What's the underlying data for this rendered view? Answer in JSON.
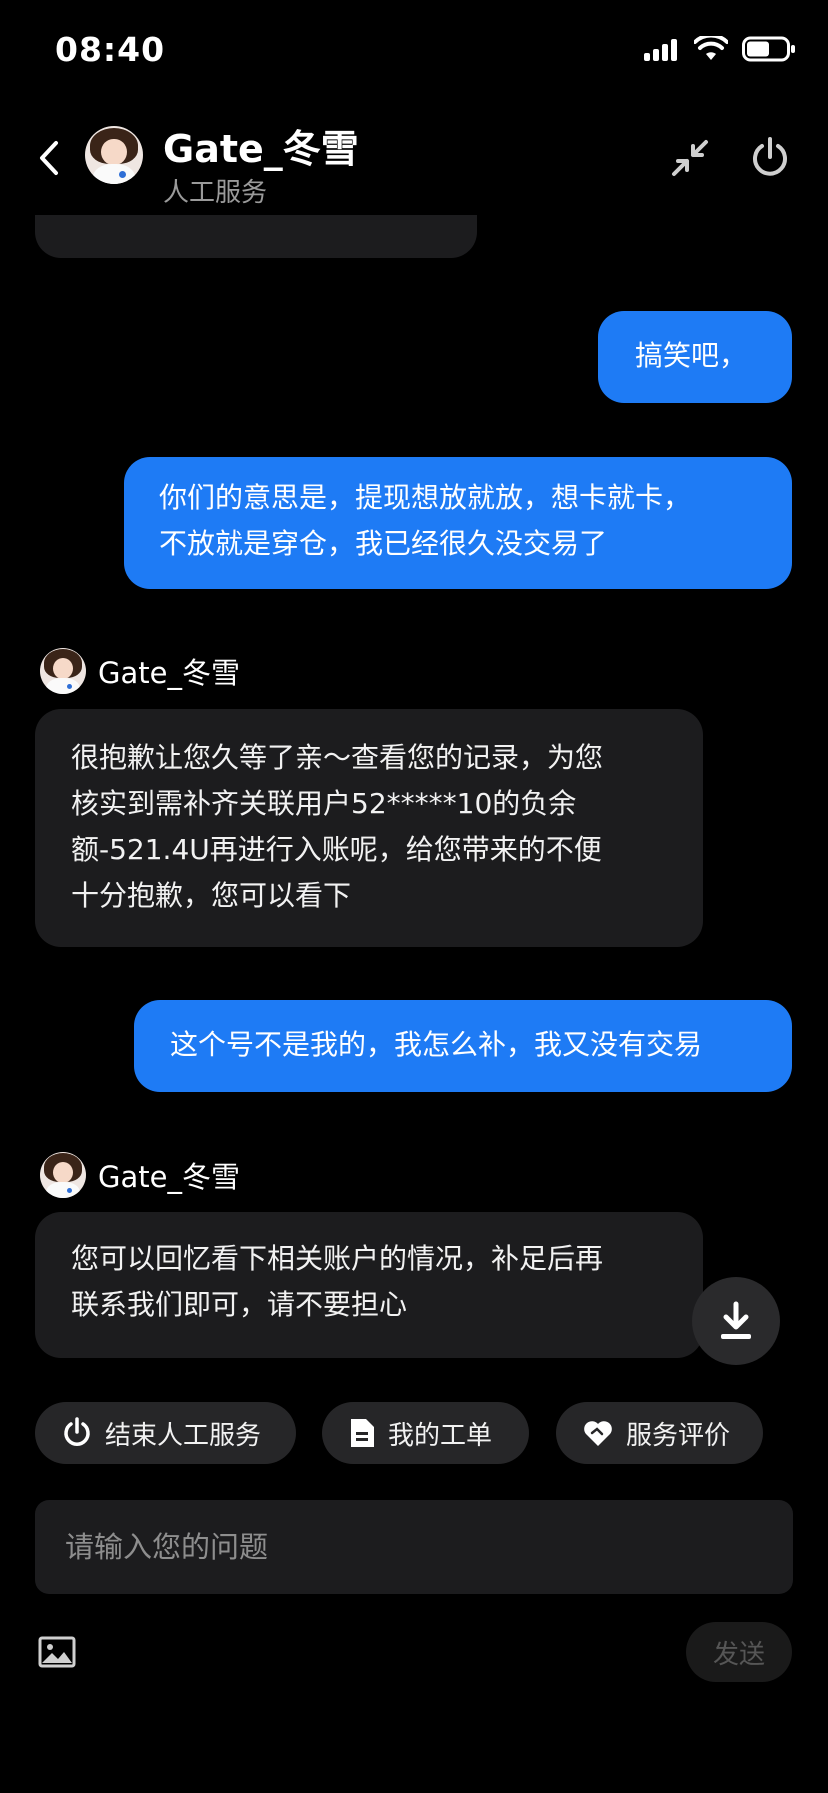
{
  "status_bar": {
    "time": "08:40"
  },
  "header": {
    "name": "Gate_冬雪",
    "subtitle": "人工服务"
  },
  "messages": [
    {
      "from": "user",
      "text": "搞笑吧，"
    },
    {
      "from": "user",
      "lines": [
        "你们的意思是，提现想放就放，想卡就卡，",
        "不放就是穿仓，我已经很久没交易了"
      ]
    },
    {
      "from": "agent",
      "sender": "Gate_冬雪",
      "lines": [
        "很抱歉让您久等了亲～查看您的记录，为您",
        "核实到需补齐关联用户52*****10的负余",
        "额-521.4U再进行入账呢，给您带来的不便",
        "十分抱歉，您可以看下"
      ]
    },
    {
      "from": "user",
      "text": "这个号不是我的，我怎么补，我又没有交易"
    },
    {
      "from": "agent",
      "sender": "Gate_冬雪",
      "lines": [
        "您可以回忆看下相关账户的情况，补足后再",
        "联系我们即可，请不要担心"
      ]
    }
  ],
  "actions": {
    "end_service": "结束人工服务",
    "my_tickets": "我的工单",
    "rate_service": "服务评价"
  },
  "composer": {
    "placeholder": "请输入您的问题",
    "send_label": "发送"
  },
  "colors": {
    "background": "#000000",
    "agent_bubble": "#1c1c1e",
    "user_bubble": "#1e7bf5",
    "chip": "#262628"
  },
  "icons": [
    "back-icon",
    "collapse-icon",
    "power-icon",
    "download-icon",
    "power-icon",
    "document-icon",
    "heart-handshake-icon",
    "image-icon"
  ]
}
